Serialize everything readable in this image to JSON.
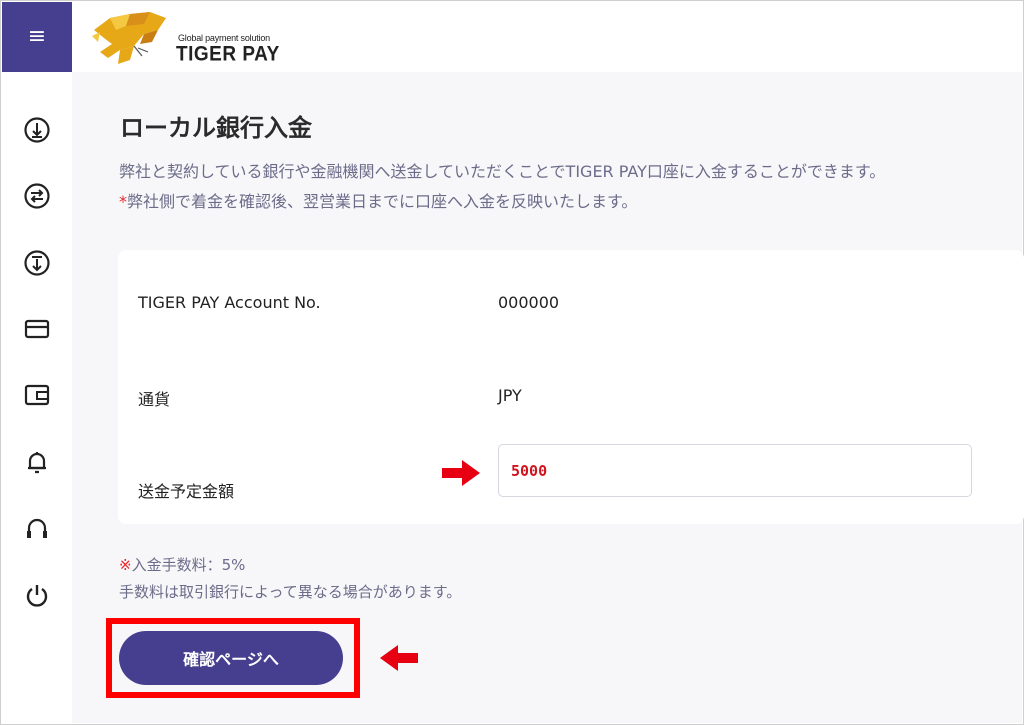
{
  "header": {
    "menu_icon": "hamburger-menu-icon",
    "menu_glyph": "≡",
    "logo_tagline": "Global payment solution",
    "logo_name": "TIGER PAY"
  },
  "sidebar": {
    "icons": [
      "deposit-icon",
      "exchange-icon",
      "withdraw-icon",
      "card-icon",
      "wallet-icon",
      "bell-icon",
      "headset-icon",
      "power-icon"
    ]
  },
  "page": {
    "title": "ローカル銀行入金",
    "desc_line1": "弊社と契約している銀行や金融機関へ送金していただくことでTIGER PAY口座に入金することができます。",
    "desc_line2_star": "*",
    "desc_line2_text": "弊社側で着金を確認後、翌営業日までに口座へ入金を反映いたします。"
  },
  "form": {
    "account_label": "TIGER PAY Account No.",
    "account_value": "000000",
    "currency_label": "通貨",
    "currency_value": "JPY",
    "amount_label": "送金予定金額",
    "amount_value": "5000"
  },
  "notes": {
    "fee_mark": "※",
    "fee_text": "入金手数料：5%",
    "fee_note": "手数料は取引銀行によって異なる場合があります。"
  },
  "actions": {
    "confirm_label": "確認ページへ"
  },
  "colors": {
    "brand": "#463f8f",
    "highlight": "#ff0000",
    "arrow": "#e60012"
  }
}
